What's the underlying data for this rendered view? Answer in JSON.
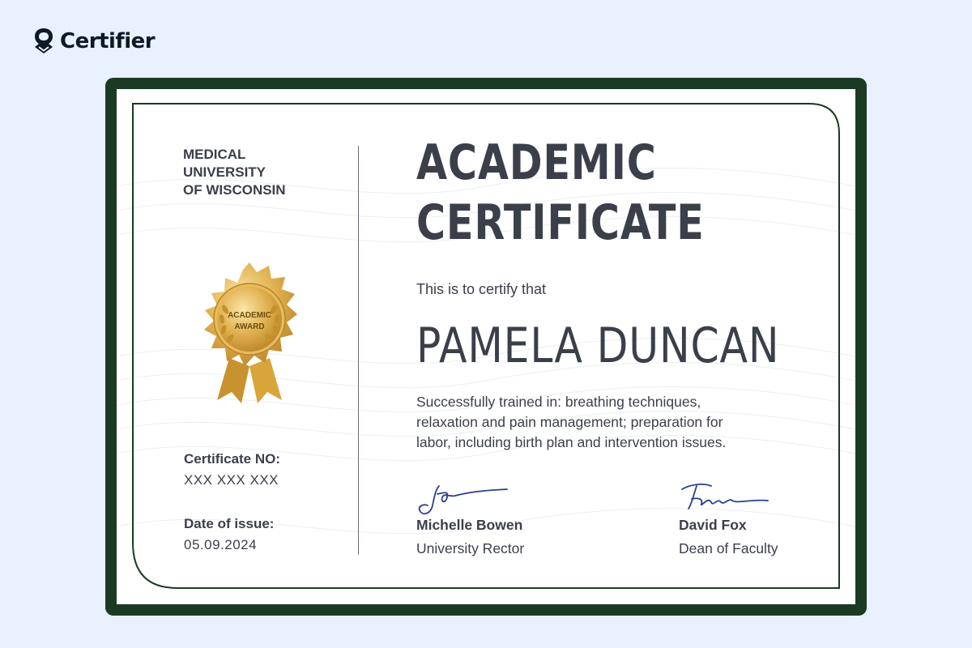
{
  "brand": {
    "name": "Certifier",
    "icon": "certifier-logo-icon"
  },
  "certificate": {
    "institution": "MEDICAL\nUNIVERSITY\nOF WISCONSIN",
    "seal": {
      "line1": "ACADEMIC",
      "line2": "AWARD",
      "icon": "gold-award-seal-icon"
    },
    "title_line1": "ACADEMIC",
    "title_line2": "CERTIFICATE",
    "intro": "This is to certify that",
    "recipient": "PAMELA DUNCAN",
    "description": "Successfully trained in: breathing techniques, relaxation and pain management; preparation for labor, including birth plan and intervention issues.",
    "certificate_no_label": "Certificate NO:",
    "certificate_no_value": "XXX XXX XXX",
    "date_label": "Date of issue:",
    "date_value": "05.09.2024",
    "signatories": [
      {
        "name": "Michelle Bowen",
        "role": "University Rector"
      },
      {
        "name": "David Fox",
        "role": "Dean of Faculty"
      }
    ]
  },
  "colors": {
    "background": "#e8f1fd",
    "frame": "#1b3a24",
    "text": "#3b3f4a",
    "gold": "#d9a53a",
    "ink": "#2b3f8f"
  }
}
